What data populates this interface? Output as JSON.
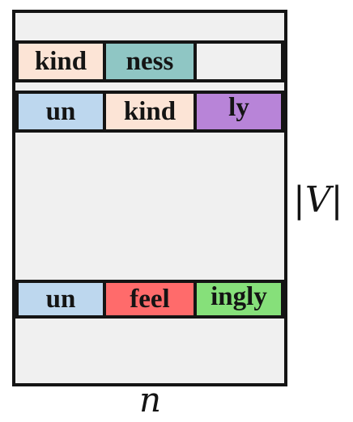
{
  "rows": [
    {
      "tokens": [
        {
          "text": "kind",
          "color": "#fce4d6"
        },
        {
          "text": "ness",
          "color": "#8fc6c4"
        },
        {
          "text": "",
          "color": "#f0f0f0"
        }
      ]
    },
    {
      "tokens": [
        {
          "text": "un",
          "color": "#bdd7ee"
        },
        {
          "text": "kind",
          "color": "#fce4d6"
        },
        {
          "text": "ly",
          "color": "#b884d8"
        }
      ]
    },
    {
      "tokens": [
        {
          "text": "un",
          "color": "#bdd7ee"
        },
        {
          "text": "feel",
          "color": "#ff6b6b"
        },
        {
          "text": "ingly",
          "color": "#86e07a"
        }
      ]
    }
  ],
  "labels": {
    "vocab_size": "|V|",
    "width": "n"
  }
}
